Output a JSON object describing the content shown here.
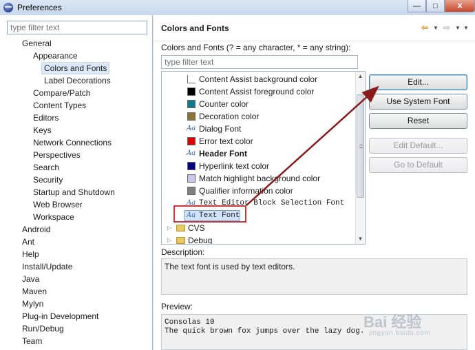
{
  "window": {
    "title": "Preferences",
    "minimize": "—",
    "maximize": "□",
    "close": "X"
  },
  "left": {
    "filter_placeholder": "type filter text",
    "tree": [
      {
        "label": "General",
        "indent": 1
      },
      {
        "label": "Appearance",
        "indent": 2
      },
      {
        "label": "Colors and Fonts",
        "indent": 3,
        "selected": true
      },
      {
        "label": "Label Decorations",
        "indent": 3
      },
      {
        "label": "Compare/Patch",
        "indent": 2
      },
      {
        "label": "Content Types",
        "indent": 2
      },
      {
        "label": "Editors",
        "indent": 2
      },
      {
        "label": "Keys",
        "indent": 2
      },
      {
        "label": "Network Connections",
        "indent": 2
      },
      {
        "label": "Perspectives",
        "indent": 2
      },
      {
        "label": "Search",
        "indent": 2
      },
      {
        "label": "Security",
        "indent": 2
      },
      {
        "label": "Startup and Shutdown",
        "indent": 2
      },
      {
        "label": "Web Browser",
        "indent": 2
      },
      {
        "label": "Workspace",
        "indent": 2
      },
      {
        "label": "Android",
        "indent": 0
      },
      {
        "label": "Ant",
        "indent": 0
      },
      {
        "label": "Help",
        "indent": 0
      },
      {
        "label": "Install/Update",
        "indent": 0
      },
      {
        "label": "Java",
        "indent": 0
      },
      {
        "label": "Maven",
        "indent": 0
      },
      {
        "label": "Mylyn",
        "indent": 0
      },
      {
        "label": "Plug-in Development",
        "indent": 0
      },
      {
        "label": "Run/Debug",
        "indent": 0
      },
      {
        "label": "Team",
        "indent": 0
      }
    ]
  },
  "right": {
    "title": "Colors and Fonts",
    "nav": {
      "back": "⇦",
      "forward": "⇨",
      "dropdown": "▼",
      "menu": "▼"
    },
    "filter_label": "Colors and Fonts (? = any character, * = any string):",
    "filter_placeholder": "type filter text",
    "items": [
      {
        "label": "Content Assist background color",
        "kind": "color",
        "color": "#ffffff"
      },
      {
        "label": "Content Assist foreground color",
        "kind": "color",
        "color": "#000000"
      },
      {
        "label": "Counter color",
        "kind": "color",
        "color": "#0e7a8c"
      },
      {
        "label": "Decoration color",
        "kind": "color",
        "color": "#8b7436"
      },
      {
        "label": "Dialog Font",
        "kind": "font"
      },
      {
        "label": "Error text color",
        "kind": "color",
        "color": "#e00000"
      },
      {
        "label": "Header Font",
        "kind": "font",
        "bold": true
      },
      {
        "label": "Hyperlink text color",
        "kind": "color",
        "color": "#000080"
      },
      {
        "label": "Match highlight background color",
        "kind": "color",
        "color": "#c8c8ec"
      },
      {
        "label": "Qualifier information color",
        "kind": "color",
        "color": "#808080"
      },
      {
        "label": "Text Editor Block Selection Font",
        "kind": "font",
        "mono": true
      },
      {
        "label": "Text Font",
        "kind": "font",
        "mono": true,
        "selected": true
      },
      {
        "label": "CVS",
        "kind": "folder"
      },
      {
        "label": "Debug",
        "kind": "folder"
      }
    ],
    "aa_glyph": "Aa",
    "buttons": [
      {
        "label": "Edit...",
        "enabled": true,
        "focus": true
      },
      {
        "label": "Use System Font",
        "enabled": true
      },
      {
        "label": "Reset",
        "enabled": true
      },
      {
        "label": "Edit Default...",
        "enabled": false
      },
      {
        "label": "Go to Default",
        "enabled": false
      }
    ],
    "description_label": "Description:",
    "description_text": "The text font is used by text editors.",
    "preview_label": "Preview:",
    "preview_lines": [
      "Consolas 10",
      "The quick brown fox jumps over the lazy dog."
    ]
  },
  "watermark": {
    "text": "Bai 经验",
    "sub": "jingyan.baidu.com"
  },
  "colors": {
    "highlight": "#d1353a",
    "arrow": "#8b1a1a"
  }
}
